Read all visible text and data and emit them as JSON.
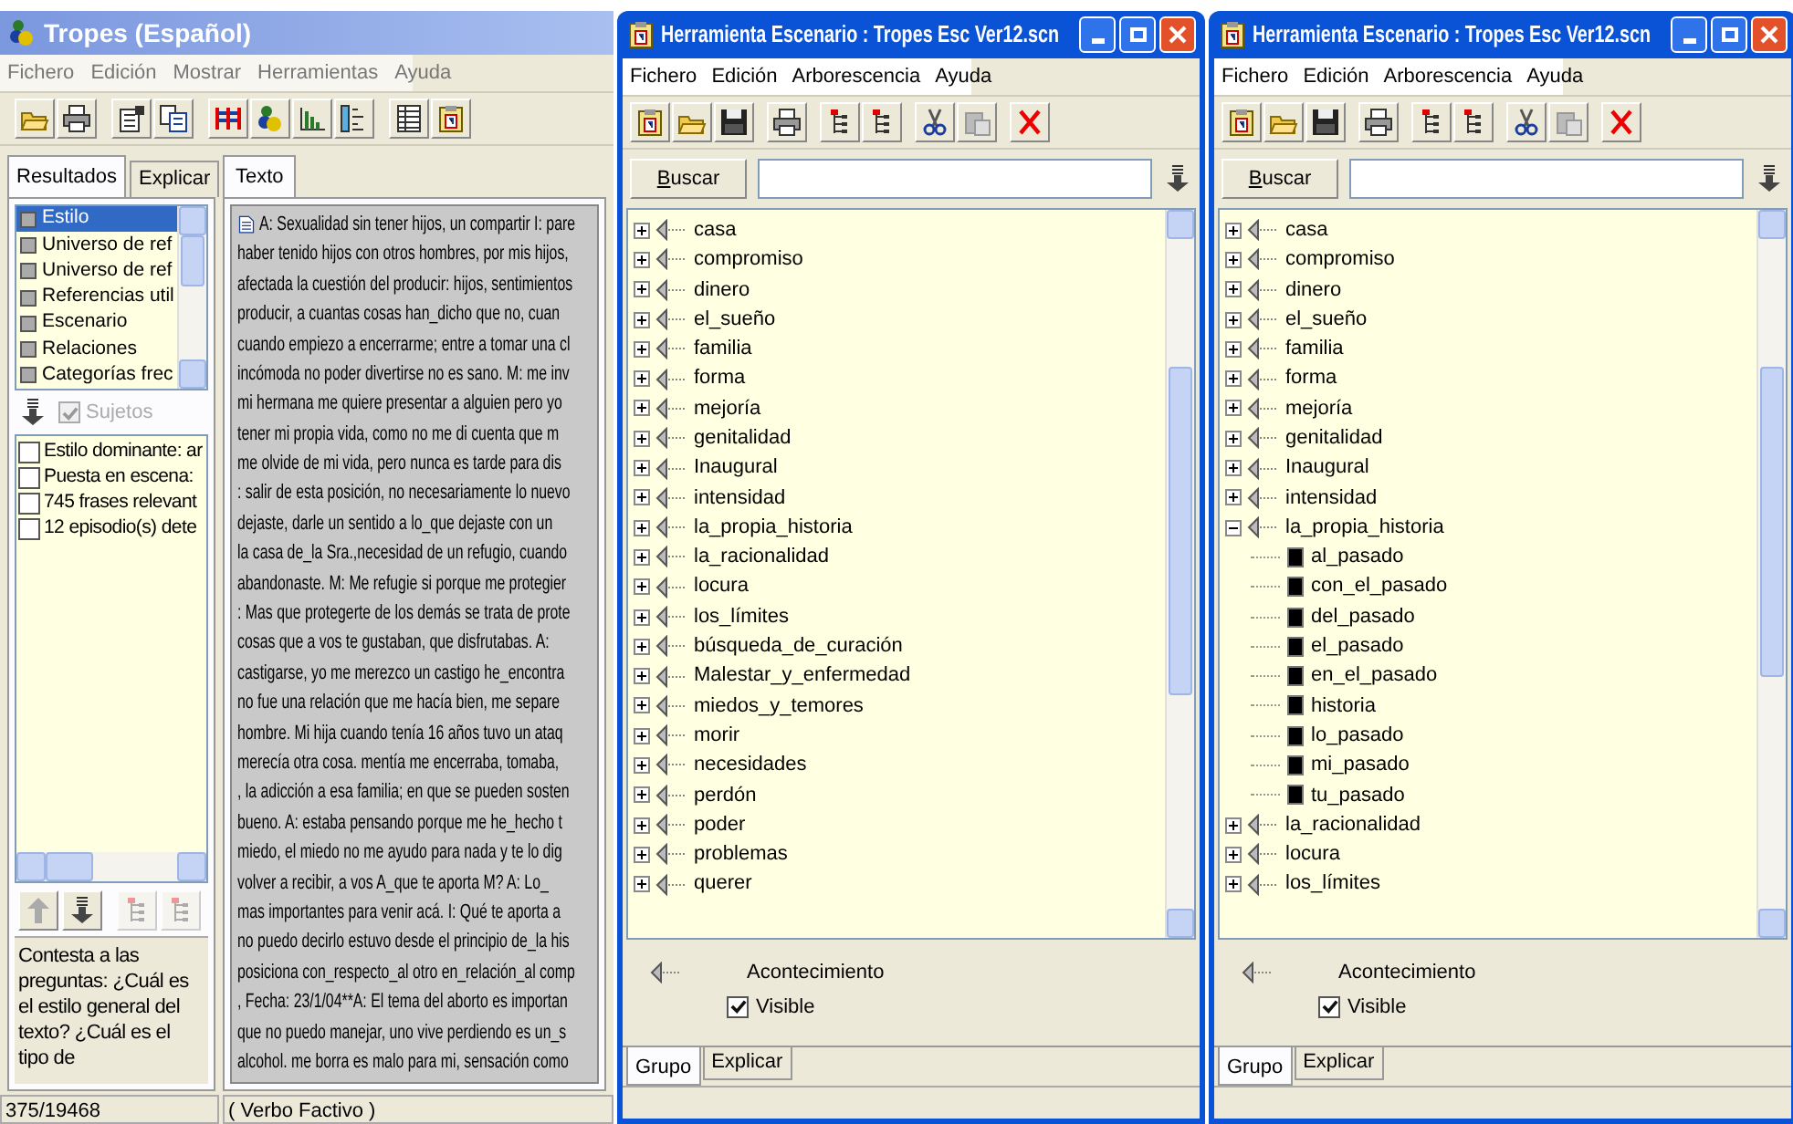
{
  "tropes": {
    "title": "Tropes (Español)",
    "menu": [
      "Fichero",
      "Edición",
      "Mostrar",
      "Herramientas",
      "Ayuda"
    ],
    "side_tabs": [
      {
        "label": "Resultados",
        "selected": true
      },
      {
        "label": "Explicar",
        "selected": false
      }
    ],
    "categories": [
      {
        "label": "Estilo",
        "selected": true
      },
      {
        "label": "Universo de ref",
        "selected": false
      },
      {
        "label": "Universo de ref",
        "selected": false
      },
      {
        "label": "Referencias util",
        "selected": false
      },
      {
        "label": "Escenario",
        "selected": false
      },
      {
        "label": "Relaciones",
        "selected": false
      },
      {
        "label": "Categorías frec",
        "selected": false
      }
    ],
    "filter": {
      "label": "Sujetos",
      "checked": true,
      "disabled": true
    },
    "results": [
      {
        "label": "Estilo dominante: ar",
        "checked": false
      },
      {
        "label": "Puesta en escena:",
        "checked": false
      },
      {
        "label": "745  frases relevant",
        "checked": false
      },
      {
        "label": "12  episodio(s) dete",
        "checked": false
      }
    ],
    "help_text": "Contesta a las preguntas: ¿Cuál es el estilo general del texto? ¿Cuál es el tipo de",
    "text_tab": "Texto",
    "text_lines": [
      "A: Sexualidad sin tener hijos,  un compartir I: pare",
      "haber tenido hijos con otros hombres, por mis hijos,",
      "afectada la cuestión del producir: hijos, sentimientos",
      "producir, a  cuantas cosas han_dicho que no, cuan",
      "cuando empiezo a encerrarme; entre a tomar una cl",
      "incómoda no poder divertirse no es sano. M: me inv",
      "mi hermana me quiere presentar a alguien pero  yo",
      "tener mi propia vida,  como no me di cuenta  que m",
      "me olvide de mi vida,  pero nunca es tarde para dis",
      ": salir de esta posición,  no necesariamente lo nuevo",
      "dejaste, darle un sentido a  lo_que dejaste con un",
      "la casa de_la Sra.,necesidad de un refugio,  cuando",
      "abandonaste. M: Me refugie si  porque me protegier",
      ": Mas que protegerte de los demás se trata de prote",
      "cosas que a  vos te gustaban,  que disfrutabas. A:",
      "castigarse,  yo me merezco un castigo he_encontra",
      "no fue una relación  que me hacía bien,  me separe",
      "hombre. Mi hija cuando tenía 16 años tuvo un ataq",
      "merecía otra cosa. mentía me encerraba,  tomaba,",
      ", la adicción a esa familia; en que se pueden sosten",
      "bueno. A: estaba pensando porque me he_hecho t",
      "miedo,  el miedo no me ayudo para nada y te lo dig",
      "volver a recibir, a  vos A_que te aporta M? A: Lo_",
      "mas importantes para venir acá. I: Qué te aporta a",
      "no puedo decirlo estuvo desde el principio de_la his",
      "posiciona con_respecto_al otro en_relación_al comp",
      ", Fecha: 23/1/04**A: El tema del aborto es importan",
      "que no puedo manejar, uno vive perdiendo es un_s",
      "alcohol. me borra es malo para mi,  sensación como"
    ],
    "status": [
      "375/19468",
      "( Verbo Factivo )"
    ]
  },
  "scenario_windows": [
    {
      "title": "Herramienta Escenario : Tropes Esc Ver12.scn",
      "menu": [
        "Fichero",
        "Edición",
        "Arborescencia",
        "Ayuda"
      ],
      "search_button": "Buscar",
      "tree": [
        {
          "label": "casa",
          "expanded": false
        },
        {
          "label": "compromiso",
          "expanded": false
        },
        {
          "label": "dinero",
          "expanded": false
        },
        {
          "label": "el_sueño",
          "expanded": false
        },
        {
          "label": "familia",
          "expanded": false
        },
        {
          "label": "forma",
          "expanded": false
        },
        {
          "label": "mejoría",
          "expanded": false
        },
        {
          "label": "genitalidad",
          "expanded": false
        },
        {
          "label": "Inaugural",
          "expanded": false
        },
        {
          "label": "intensidad",
          "expanded": false
        },
        {
          "label": "la_propia_historia",
          "expanded": false
        },
        {
          "label": "la_racionalidad",
          "expanded": false
        },
        {
          "label": "locura",
          "expanded": false
        },
        {
          "label": "los_límites",
          "expanded": false
        },
        {
          "label": "búsqueda_de_curación",
          "expanded": false
        },
        {
          "label": "Malestar_y_enfermedad",
          "expanded": false
        },
        {
          "label": "miedos_y_temores",
          "expanded": false
        },
        {
          "label": "morir",
          "expanded": false
        },
        {
          "label": "necesidades",
          "expanded": false
        },
        {
          "label": "perdón",
          "expanded": false
        },
        {
          "label": "poder",
          "expanded": false
        },
        {
          "label": "problemas",
          "expanded": false
        },
        {
          "label": "querer",
          "expanded": false
        }
      ],
      "legend": "Acontecimiento",
      "visible": {
        "label": "Visible",
        "checked": true
      },
      "tabs": [
        {
          "label": "Grupo",
          "selected": true
        },
        {
          "label": "Explicar",
          "selected": false
        }
      ]
    },
    {
      "title": "Herramienta Escenario : Tropes Esc Ver12.scn",
      "menu": [
        "Fichero",
        "Edición",
        "Arborescencia",
        "Ayuda"
      ],
      "search_button": "Buscar",
      "tree": [
        {
          "label": "casa",
          "expanded": false
        },
        {
          "label": "compromiso",
          "expanded": false
        },
        {
          "label": "dinero",
          "expanded": false
        },
        {
          "label": "el_sueño",
          "expanded": false
        },
        {
          "label": "familia",
          "expanded": false
        },
        {
          "label": "forma",
          "expanded": false
        },
        {
          "label": "mejoría",
          "expanded": false
        },
        {
          "label": "genitalidad",
          "expanded": false
        },
        {
          "label": "Inaugural",
          "expanded": false
        },
        {
          "label": "intensidad",
          "expanded": false
        },
        {
          "label": "la_propia_historia",
          "expanded": true,
          "children": [
            {
              "label": "al_pasado"
            },
            {
              "label": "con_el_pasado"
            },
            {
              "label": "del_pasado"
            },
            {
              "label": "el_pasado"
            },
            {
              "label": "en_el_pasado"
            },
            {
              "label": "historia"
            },
            {
              "label": "lo_pasado"
            },
            {
              "label": "mi_pasado"
            },
            {
              "label": "tu_pasado"
            }
          ]
        },
        {
          "label": "la_racionalidad",
          "expanded": false
        },
        {
          "label": "locura",
          "expanded": false
        },
        {
          "label": "los_límites",
          "expanded": false
        }
      ],
      "legend": "Acontecimiento",
      "visible": {
        "label": "Visible",
        "checked": true
      },
      "tabs": [
        {
          "label": "Grupo",
          "selected": true
        },
        {
          "label": "Explicar",
          "selected": false
        }
      ]
    }
  ]
}
